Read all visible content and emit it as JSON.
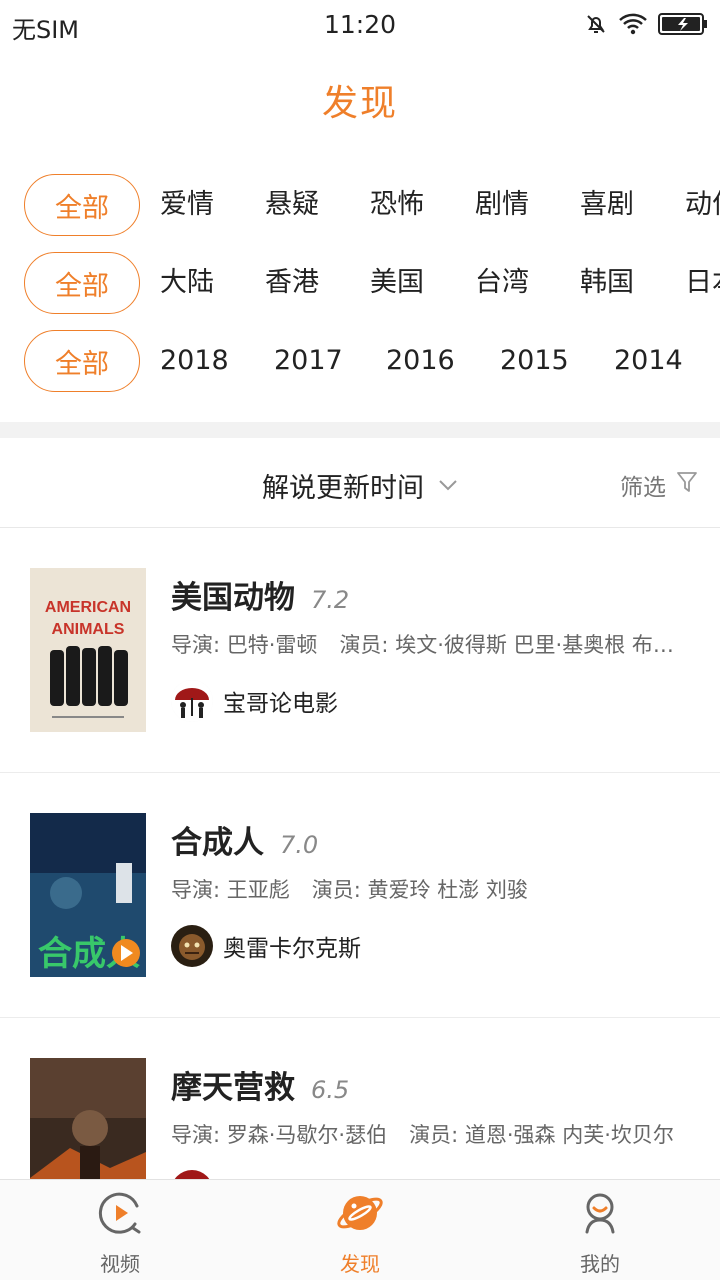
{
  "status_bar": {
    "carrier": "无SIM",
    "time": "11:20",
    "icons": [
      "mute-icon",
      "wifi-icon",
      "battery-charging-icon"
    ]
  },
  "header": {
    "title": "发现"
  },
  "filters": {
    "genre": {
      "all_label": "全部",
      "items": [
        "爱情",
        "悬疑",
        "恐怖",
        "剧情",
        "喜剧",
        "动作"
      ]
    },
    "region": {
      "all_label": "全部",
      "items": [
        "大陆",
        "香港",
        "美国",
        "台湾",
        "韩国",
        "日本"
      ]
    },
    "year": {
      "all_label": "全部",
      "items": [
        "2018",
        "2017",
        "2016",
        "2015",
        "2014"
      ]
    }
  },
  "sort_bar": {
    "sort_label": "解说更新时间",
    "sort_icon": "chevron-down-icon",
    "filter_label": "筛选",
    "filter_icon": "funnel-icon"
  },
  "movies": [
    {
      "title": "美国动物",
      "rating": "7.2",
      "director": "导演: 巴特·雷顿",
      "cast": "演员: 埃文·彼得斯 巴里·基奥根 布莱克·詹纳",
      "uploader": "宝哥论电影",
      "poster_text": "AMERICAN ANIMALS"
    },
    {
      "title": "合成人",
      "rating": "7.0",
      "director": "导演: 王亚彪",
      "cast": "演员: 黄爱玲 杜澎 刘骏",
      "uploader": "奥雷卡尔克斯",
      "poster_text": "合成人"
    },
    {
      "title": "摩天营救",
      "rating": "6.5",
      "director": "导演: 罗森·马歇尔·瑟伯",
      "cast": "演员: 道恩·强森 内芙·坎贝尔",
      "uploader": "",
      "poster_text": ""
    }
  ],
  "bottom_nav": {
    "items": [
      {
        "label": "视频",
        "icon": "video-play-icon",
        "active": false
      },
      {
        "label": "发现",
        "icon": "planet-icon",
        "active": true
      },
      {
        "label": "我的",
        "icon": "profile-icon",
        "active": false
      }
    ]
  },
  "colors": {
    "accent": "#ef7f2a",
    "text": "#222222",
    "muted": "#666666",
    "divider": "#e8e8e8"
  }
}
